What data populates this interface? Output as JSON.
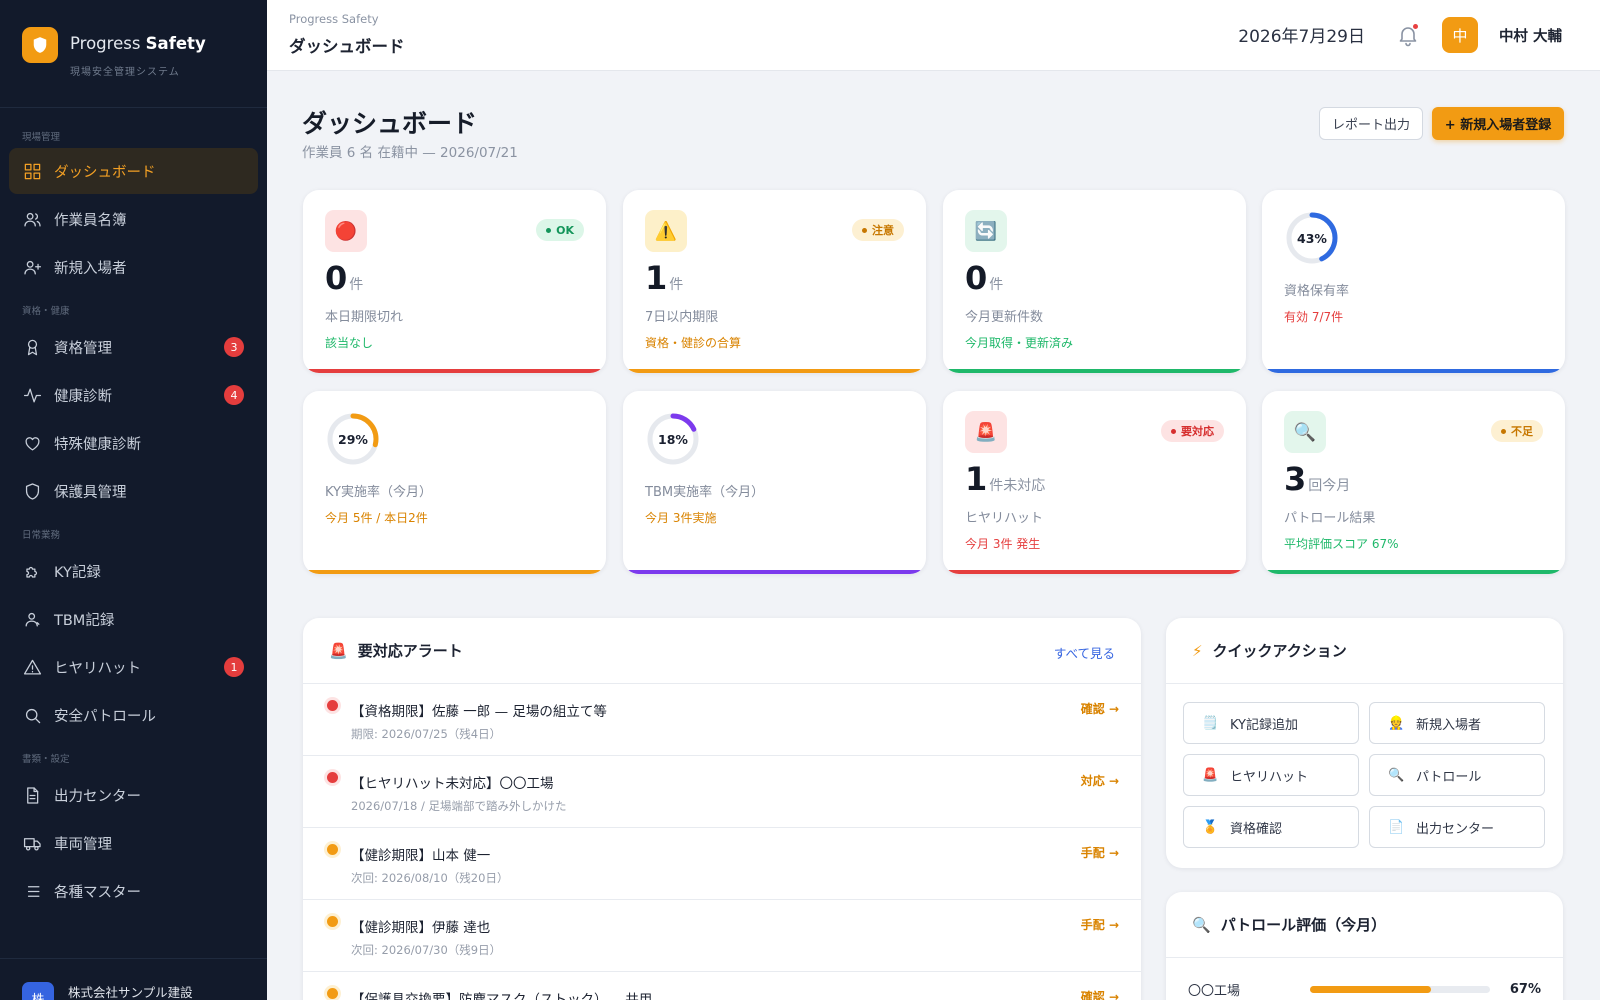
{
  "app": {
    "brand_light": "Progress",
    "brand_bold": "Safety",
    "subtitle": "現場安全管理システム"
  },
  "sidebar": {
    "sections": [
      "現場管理",
      "資格・健康",
      "日常業務",
      "書類・設定"
    ],
    "items": [
      {
        "label": "ダッシュボード",
        "icon": "grid-icon"
      },
      {
        "label": "作業員名簿",
        "icon": "users-icon"
      },
      {
        "label": "新規入場者",
        "icon": "user-plus-icon"
      },
      {
        "label": "資格管理",
        "icon": "award-icon",
        "badge": "3"
      },
      {
        "label": "健康診断",
        "icon": "pulse-icon",
        "badge": "4"
      },
      {
        "label": "特殊健康診断",
        "icon": "heart-icon"
      },
      {
        "label": "保護具管理",
        "icon": "shield-icon"
      },
      {
        "label": "KY記録",
        "icon": "puzzle-icon"
      },
      {
        "label": "TBM記録",
        "icon": "user-icon"
      },
      {
        "label": "ヒヤリハット",
        "icon": "warning-icon",
        "badge": "1"
      },
      {
        "label": "安全パトロール",
        "icon": "search-icon"
      },
      {
        "label": "出力センター",
        "icon": "document-icon"
      },
      {
        "label": "車両管理",
        "icon": "truck-icon"
      },
      {
        "label": "各種マスター",
        "icon": "list-icon"
      }
    ],
    "company": {
      "avatar": "株",
      "name": "株式会社サンプル建設"
    }
  },
  "topbar": {
    "crumb": "Progress Safety",
    "title": "ダッシュボード",
    "date": "2026年7月29日",
    "avatar": "中",
    "user": "中村 大輔"
  },
  "header": {
    "title": "ダッシュボード",
    "subtitle": "作業員 6 名 在籍中 — 2026/07/21",
    "report_button": "レポート出力",
    "new_button": "+ 新規入場者登録"
  },
  "stats": [
    {
      "icon": "🔴",
      "tag": "OK",
      "number": "0",
      "unit": "件",
      "label": "本日期限切れ",
      "note": "該当なし"
    },
    {
      "icon": "⚠️",
      "tag": "注意",
      "number": "1",
      "unit": "件",
      "label": "7日以内期限",
      "note": "資格・健診の合算"
    },
    {
      "icon": "🔄",
      "tag": "",
      "number": "0",
      "unit": "件",
      "label": "今月更新件数",
      "note": "今月取得・更新済み"
    },
    {
      "percent": 43,
      "percent_label": "43%",
      "label": "資格保有率",
      "note": "有効 7/7件"
    },
    {
      "percent": 29,
      "percent_label": "29%",
      "label": "KY実施率（今月）",
      "note": "今月 5件 / 本日2件"
    },
    {
      "percent": 18,
      "percent_label": "18%",
      "label": "TBM実施率（今月）",
      "note": "今月 3件実施"
    },
    {
      "icon": "🚨",
      "tag": "要対応",
      "number": "1",
      "unit": "件未対応",
      "label": "ヒヤリハット",
      "note": "今月 3件 発生"
    },
    {
      "icon": "🔍",
      "tag": "不足",
      "number": "3",
      "unit": "回今月",
      "label": "パトロール結果",
      "note": "平均評価スコア 67%"
    }
  ],
  "colors": {
    "red": "#e53e3e",
    "orange": "#f29b13",
    "green": "#1fb86a",
    "blue": "#2f6ae0",
    "purple": "#7c3aed",
    "accent": "#f29b13"
  },
  "alerts": {
    "title": "要対応アラート",
    "icon": "🚨",
    "link": "すべて見る",
    "items": [
      {
        "title": "【資格期限】佐藤 一郎 — 足場の組立て等",
        "sub": "期限: 2026/07/25（残4日）",
        "action": "確認 →",
        "level": "red"
      },
      {
        "title": "【ヒヤリハット未対応】〇〇工場",
        "sub": "2026/07/18 / 足場端部で踏み外しかけた",
        "action": "対応 →",
        "level": "red"
      },
      {
        "title": "【健診期限】山本 健一",
        "sub": "次回: 2026/08/10（残20日）",
        "action": "手配 →",
        "level": "orange"
      },
      {
        "title": "【健診期限】伊藤 達也",
        "sub": "次回: 2026/07/30（残9日）",
        "action": "手配 →",
        "level": "orange"
      },
      {
        "title": "【保護具交換要】防塵マスク（ストック）— 共用",
        "sub": "",
        "action": "確認 →",
        "level": "orange"
      }
    ]
  },
  "quick_actions": {
    "title": "クイックアクション",
    "icon": "⚡",
    "items": [
      {
        "label": "KY記録追加",
        "icon": "🗒️"
      },
      {
        "label": "新規入場者",
        "icon": "👷"
      },
      {
        "label": "ヒヤリハット",
        "icon": "🚨"
      },
      {
        "label": "パトロール",
        "icon": "🔍"
      },
      {
        "label": "資格確認",
        "icon": "🏅"
      },
      {
        "label": "出力センター",
        "icon": "📄"
      }
    ]
  },
  "patrol": {
    "title": "パトロール評価（今月）",
    "icon": "🔍",
    "rows": [
      {
        "name": "〇〇工場",
        "value": 67,
        "label": "67%"
      }
    ]
  }
}
